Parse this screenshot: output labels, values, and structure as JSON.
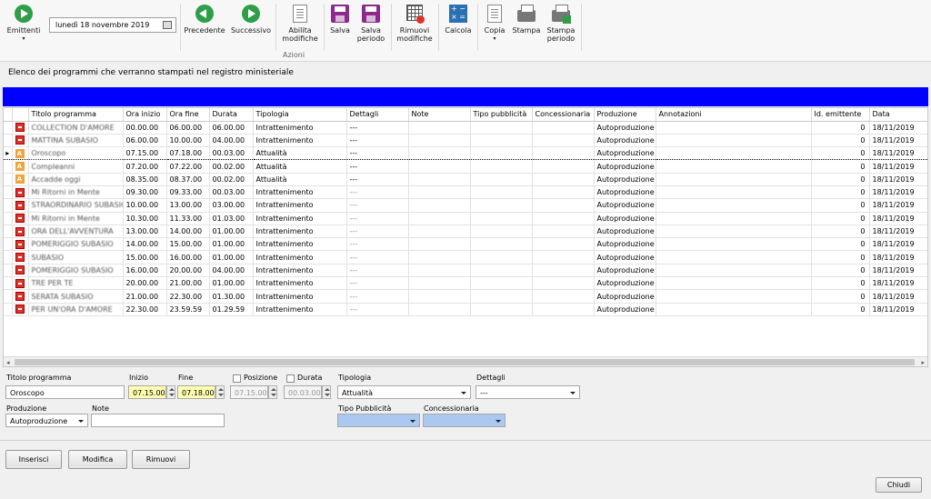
{
  "ribbon": {
    "emittenti": "Emittenti",
    "date_value": "lunedì    18 novembre 2019",
    "precedente": "Precedente",
    "successivo": "Successivo",
    "abilita": "Abilita\nmodifiche",
    "group_label": "Azioni",
    "salva": "Salva",
    "salva_periodo": "Salva\nperiodo",
    "rimuovi": "Rimuovi\nmodifiche",
    "calcola": "Calcola",
    "copia": "Copia",
    "stampa": "Stampa",
    "stampa_periodo": "Stampa\nperiodo"
  },
  "page_title": "Elenco dei programmi che verranno stampati nel registro ministeriale",
  "table": {
    "headers": [
      "Titolo programma",
      "Ora inizio",
      "Ora fine",
      "Durata",
      "Tipologia",
      "Dettagli",
      "Note",
      "Tipo pubblicità",
      "Concessionaria",
      "Produzione",
      "Annotazioni",
      "Id. emittente",
      "Data"
    ],
    "rows": [
      {
        "icon": "red",
        "title": "COLLECTION D'AMORE",
        "start": "00.00.00",
        "end": "06.00.00",
        "dur": "06.00.00",
        "type": "Intrattenimento",
        "det": "---",
        "prod": "Autoproduzione",
        "id": "0",
        "date": "18/11/2019"
      },
      {
        "icon": "red",
        "title": "MATTINA SUBASIO",
        "start": "06.00.00",
        "end": "10.00.00",
        "dur": "04.00.00",
        "type": "Intrattenimento",
        "det": "---",
        "prod": "Autoproduzione",
        "id": "0",
        "date": "18/11/2019"
      },
      {
        "icon": "orange",
        "title": "Oroscopo",
        "start": "07.15.00",
        "end": "07.18.00",
        "dur": "00.03.00",
        "type": "Attualità",
        "det": "---",
        "prod": "Autoproduzione",
        "id": "0",
        "date": "18/11/2019",
        "sel": true
      },
      {
        "icon": "orange",
        "title": "Compleanni",
        "start": "07.20.00",
        "end": "07.22.00",
        "dur": "00.02.00",
        "type": "Attualità",
        "det": "---",
        "prod": "Autoproduzione",
        "id": "0",
        "date": "18/11/2019"
      },
      {
        "icon": "orange",
        "title": "Accadde oggi",
        "start": "08.35.00",
        "end": "08.37.00",
        "dur": "00.02.00",
        "type": "Attualità",
        "det": "---",
        "prod": "Autoproduzione",
        "id": "0",
        "date": "18/11/2019"
      },
      {
        "icon": "red",
        "title": "Mi Ritorni in Mente",
        "start": "09.30.00",
        "end": "09.33.00",
        "dur": "00.03.00",
        "type": "Intrattenimento",
        "det": "---",
        "prod": "Autoproduzione",
        "id": "0",
        "date": "18/11/2019"
      },
      {
        "icon": "red",
        "title": "STRAORDINARIO SUBASIO",
        "start": "10.00.00",
        "end": "13.00.00",
        "dur": "03.00.00",
        "type": "Intrattenimento",
        "det": "---",
        "prod": "Autoproduzione",
        "id": "0",
        "date": "18/11/2019"
      },
      {
        "icon": "red",
        "title": "Mi Ritorni in Mente",
        "start": "10.30.00",
        "end": "11.33.00",
        "dur": "01.03.00",
        "type": "Intrattenimento",
        "det": "---",
        "prod": "Autoproduzione",
        "id": "0",
        "date": "18/11/2019"
      },
      {
        "icon": "red",
        "title": "ORA DELL'AVVENTURA",
        "start": "13.00.00",
        "end": "14.00.00",
        "dur": "01.00.00",
        "type": "Intrattenimento",
        "det": "---",
        "prod": "Autoproduzione",
        "id": "0",
        "date": "18/11/2019"
      },
      {
        "icon": "red",
        "title": "POMERIGGIO SUBASIO",
        "start": "14.00.00",
        "end": "15.00.00",
        "dur": "01.00.00",
        "type": "Intrattenimento",
        "det": "---",
        "prod": "Autoproduzione",
        "id": "0",
        "date": "18/11/2019"
      },
      {
        "icon": "red",
        "title": "SUBASIO",
        "start": "15.00.00",
        "end": "16.00.00",
        "dur": "01.00.00",
        "type": "Intrattenimento",
        "det": "---",
        "prod": "Autoproduzione",
        "id": "0",
        "date": "18/11/2019"
      },
      {
        "icon": "red",
        "title": "POMERIGGIO SUBASIO",
        "start": "16.00.00",
        "end": "20.00.00",
        "dur": "04.00.00",
        "type": "Intrattenimento",
        "det": "---",
        "prod": "Autoproduzione",
        "id": "0",
        "date": "18/11/2019"
      },
      {
        "icon": "red",
        "title": "TRE PER TE",
        "start": "20.00.00",
        "end": "21.00.00",
        "dur": "01.00.00",
        "type": "Intrattenimento",
        "det": "---",
        "prod": "Autoproduzione",
        "id": "0",
        "date": "18/11/2019"
      },
      {
        "icon": "red",
        "title": "SERATA SUBASIO",
        "start": "21.00.00",
        "end": "22.30.00",
        "dur": "01.30.00",
        "type": "Intrattenimento",
        "det": "---",
        "prod": "Autoproduzione",
        "id": "0",
        "date": "18/11/2019"
      },
      {
        "icon": "red",
        "title": "PER UN'ORA D'AMORE",
        "start": "22.30.00",
        "end": "23.59.59",
        "dur": "01.29.59",
        "type": "Intrattenimento",
        "det": "---",
        "prod": "Autoproduzione",
        "id": "0",
        "date": "18/11/2019"
      }
    ]
  },
  "form": {
    "titolo_label": "Titolo programma",
    "titolo_value": "Oroscopo",
    "inizio_label": "Inizio",
    "inizio_value": "07.15.00",
    "fine_label": "Fine",
    "fine_value": "07.18.00",
    "posizione_label": "Posizione",
    "posizione_value": "07.15.00",
    "durata_label": "Durata",
    "durata_value": "00.03.00",
    "tipologia_label": "Tipologia",
    "tipologia_value": "Attualità",
    "dettagli_label": "Dettagli",
    "dettagli_value": "---",
    "produzione_label": "Produzione",
    "produzione_value": "Autoproduzione",
    "note_label": "Note",
    "note_value": "",
    "tipo_pub_label": "Tipo Pubblicità",
    "concessionaria_label": "Concessionaria"
  },
  "buttons": {
    "inserisci": "Inserisci",
    "modifica": "Modifica",
    "rimuovi": "Rimuovi",
    "chiudi": "Chiudi"
  }
}
